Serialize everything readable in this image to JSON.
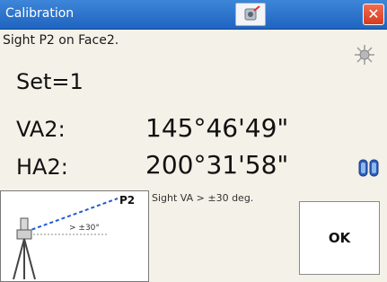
{
  "window": {
    "title": "Calibration",
    "close_symbol": "✕"
  },
  "instruction": "Sight P2 on Face2.",
  "set": "Set=1",
  "va": {
    "label": "VA2:",
    "value": "145°46'49\""
  },
  "ha": {
    "label": "HA2:",
    "value": "200°31'58\""
  },
  "diagram": {
    "point_label": "P2",
    "angle_label": "> ±30°"
  },
  "hint": "Sight VA > ±30 deg.",
  "ok_label": "OK",
  "icons": {
    "title": "instrument-icon",
    "close": "close-icon",
    "sun": "sun-icon",
    "battery": "battery-icon"
  }
}
